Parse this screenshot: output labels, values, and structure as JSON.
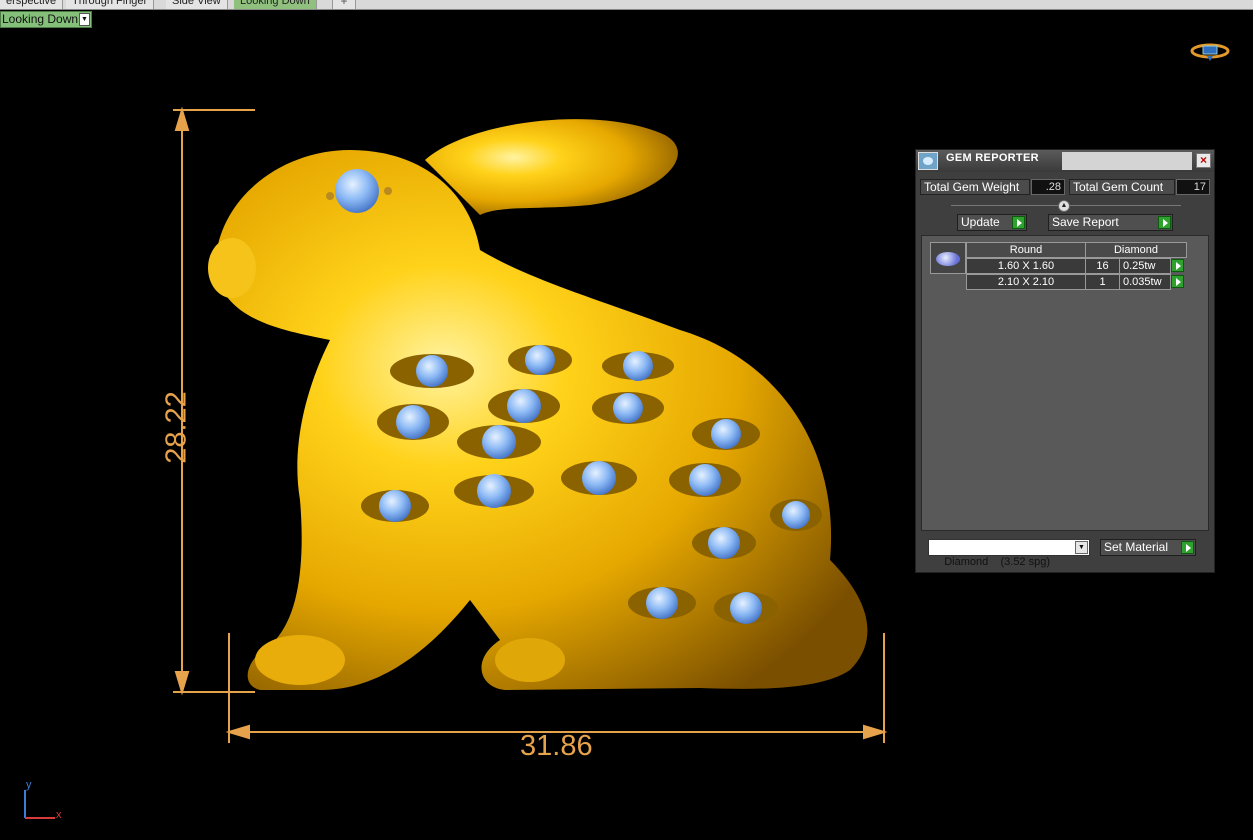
{
  "tabs": [
    {
      "label": "erspective"
    },
    {
      "label": "Through Finger"
    },
    {
      "label": "Side View"
    },
    {
      "label": "Looking Down"
    }
  ],
  "tab_add_label": "+",
  "view_selector": {
    "value": "Looking Down"
  },
  "dimensions": {
    "width": "31.86",
    "height": "28.22"
  },
  "axes": {
    "x": "x",
    "y": "y"
  },
  "gem_reporter": {
    "title": "GEM REPORTER",
    "close_label": "×",
    "total_weight_label": "Total Gem Weight",
    "total_weight_value": ".28",
    "total_count_label": "Total Gem Count",
    "total_count_value": "17",
    "update_label": "Update",
    "save_report_label": "Save Report",
    "table": {
      "headers": [
        "Round",
        "Diamond"
      ],
      "rows": [
        {
          "size": "1.60 X 1.60",
          "count": "16",
          "weight": "0.25tw"
        },
        {
          "size": "2.10 X 2.10",
          "count": "1",
          "weight": "0.035tw"
        }
      ]
    },
    "material_select": "Diamond    (3.52 spg)",
    "set_material_label": "Set Material"
  },
  "colors": {
    "gold": "#f2b600",
    "dimension": "#e7a24c",
    "gem": "#7fb1f5"
  }
}
